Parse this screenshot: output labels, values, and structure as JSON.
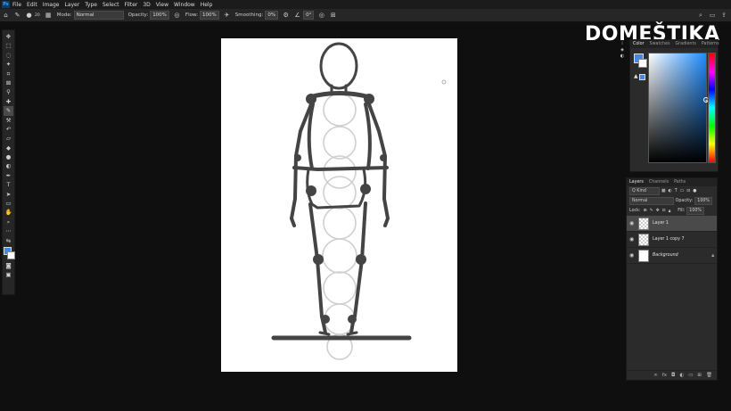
{
  "menu": [
    "File",
    "Edit",
    "Image",
    "Layer",
    "Type",
    "Select",
    "Filter",
    "3D",
    "View",
    "Window",
    "Help"
  ],
  "app_logo": "Ps",
  "options": {
    "brush_size": "20",
    "mode_label": "Mode:",
    "mode_value": "Normal",
    "opacity_label": "Opacity:",
    "opacity_value": "100%",
    "flow_label": "Flow:",
    "flow_value": "100%",
    "smoothing_label": "Smoothing:",
    "smoothing_value": "0%",
    "angle_value": "0°"
  },
  "watermark": "DOMEŠTIKA",
  "color_panel": {
    "tabs": [
      "Color",
      "Swatches",
      "Gradients",
      "Patterns"
    ],
    "foreground": "#3d8be6",
    "background": "#ffffff"
  },
  "layers_panel": {
    "tabs": [
      "Layers",
      "Channels",
      "Paths"
    ],
    "filter_label": "Q Kind",
    "blend_mode": "Normal",
    "opacity_label": "Opacity:",
    "opacity_value": "100%",
    "lock_label": "Lock:",
    "fill_label": "Fill:",
    "fill_value": "100%",
    "layers": [
      {
        "name": "Layer 1",
        "selected": true
      },
      {
        "name": "Layer 1 copy 7",
        "selected": false
      },
      {
        "name": "Background",
        "selected": false
      }
    ]
  }
}
